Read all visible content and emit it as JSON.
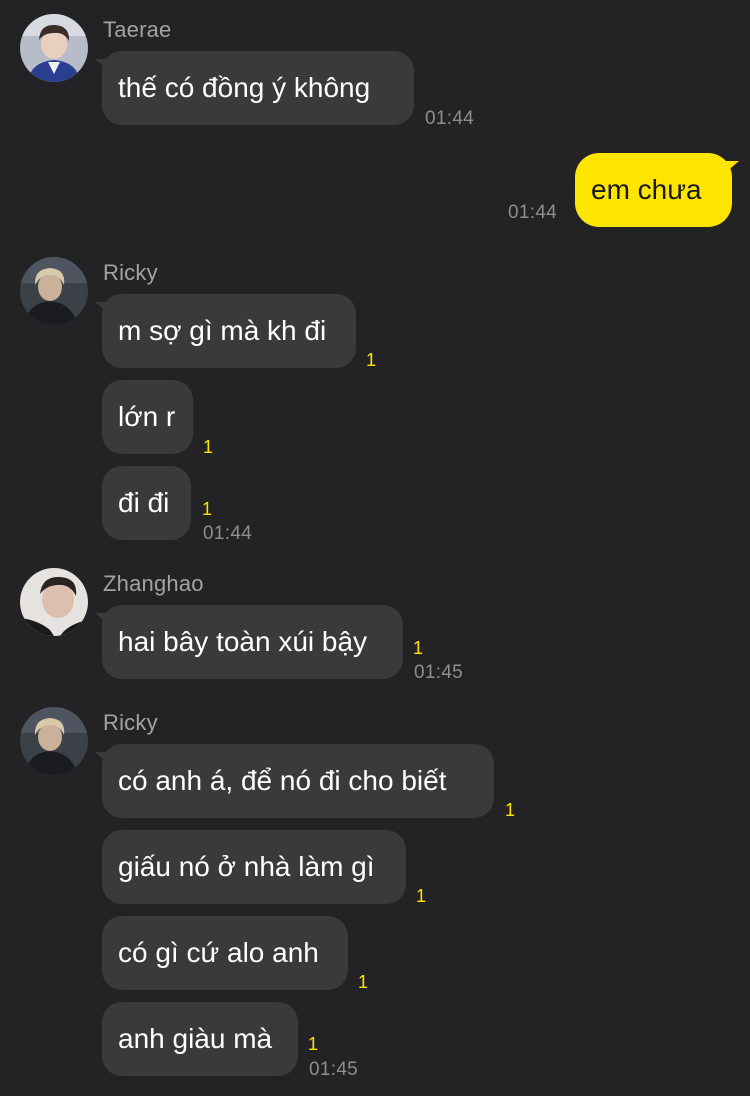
{
  "colors": {
    "background": "#232325",
    "bubble_incoming": "#3a3a3c",
    "bubble_outgoing": "#fee500",
    "unread_count": "#fee500",
    "timestamp": "#8e8e90",
    "sender_name": "#a3a3a5"
  },
  "groups": [
    {
      "sender": "Taerae",
      "avatar": "taerae-avatar",
      "messages": [
        {
          "text": "thế có đồng ý không",
          "unread": "",
          "time": "01:44"
        }
      ]
    },
    {
      "sender": "me",
      "messages": [
        {
          "text": "em chưa",
          "unread": "",
          "time": "01:44"
        }
      ]
    },
    {
      "sender": "Ricky",
      "avatar": "ricky-avatar",
      "messages": [
        {
          "text": "m sợ gì mà kh đi",
          "unread": "1",
          "time": ""
        },
        {
          "text": "lớn r",
          "unread": "1",
          "time": ""
        },
        {
          "text": "đi đi",
          "unread": "1",
          "time": "01:44"
        }
      ]
    },
    {
      "sender": "Zhanghao",
      "avatar": "zhanghao-avatar",
      "messages": [
        {
          "text": "hai bây toàn xúi bậy",
          "unread": "1",
          "time": "01:45"
        }
      ]
    },
    {
      "sender": "Ricky",
      "avatar": "ricky-avatar",
      "messages": [
        {
          "text": "có anh á, để nó đi cho biết",
          "unread": "1",
          "time": ""
        },
        {
          "text": "giấu nó ở nhà làm gì",
          "unread": "1",
          "time": ""
        },
        {
          "text": "có gì cứ alo anh",
          "unread": "1",
          "time": ""
        },
        {
          "text": "anh giàu mà",
          "unread": "1",
          "time": "01:45"
        }
      ]
    }
  ]
}
